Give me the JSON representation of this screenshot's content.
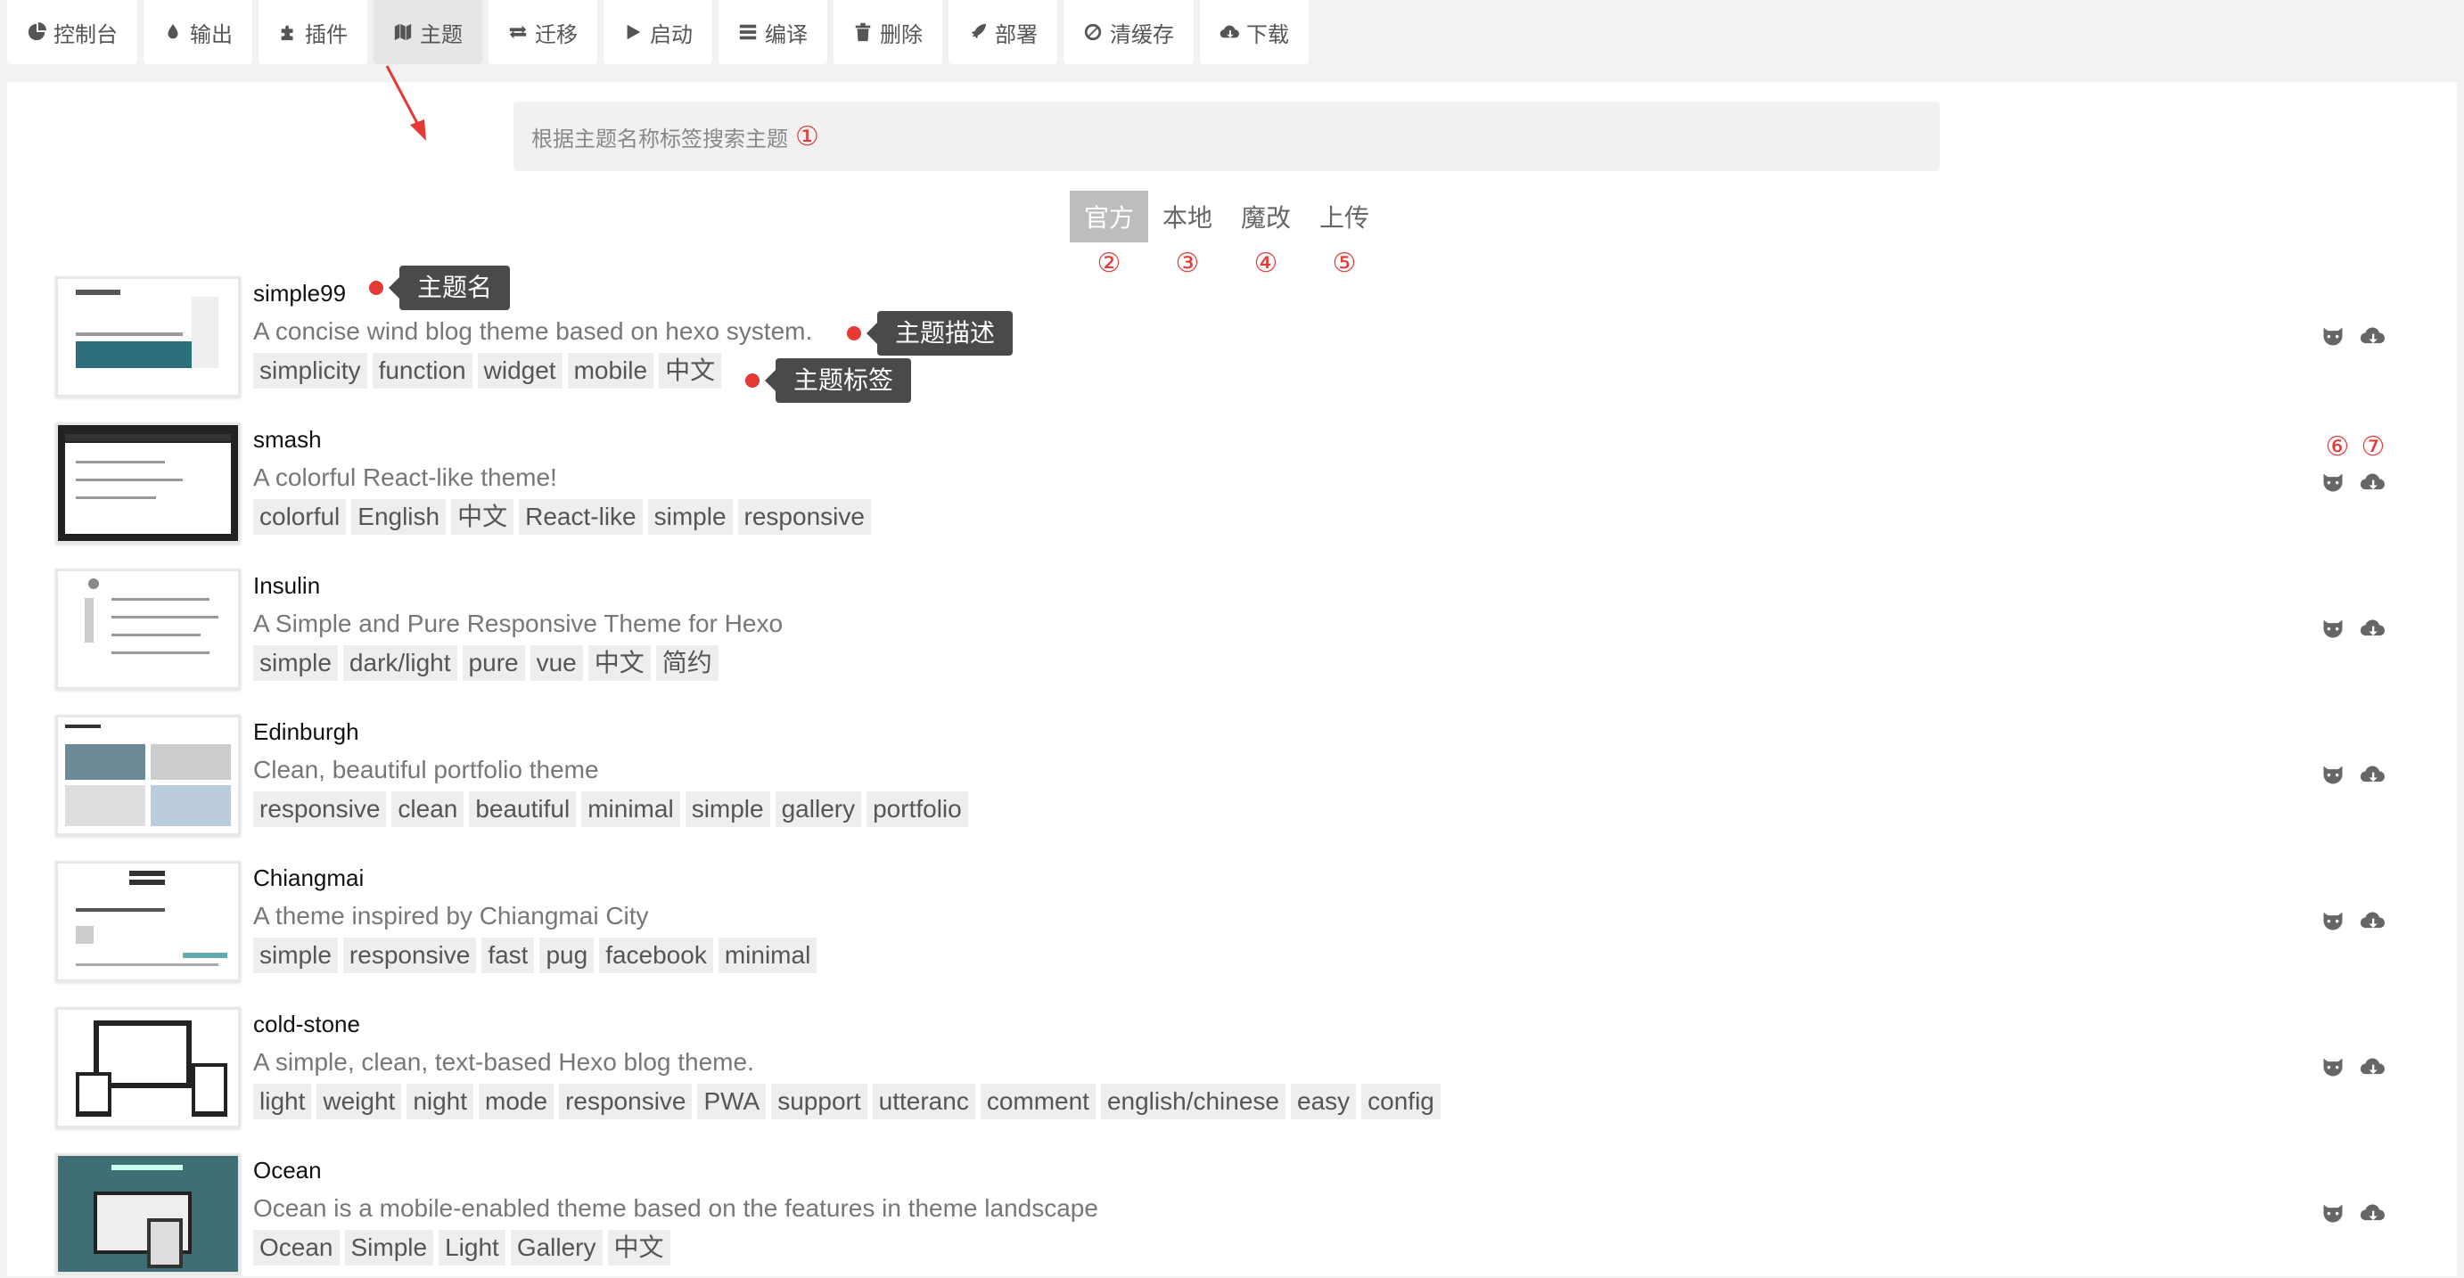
{
  "toolbar": {
    "items": [
      {
        "label": "控制台",
        "icon": "dashboard-icon"
      },
      {
        "label": "输出",
        "icon": "drop-icon"
      },
      {
        "label": "插件",
        "icon": "puzzle-icon"
      },
      {
        "label": "主题",
        "icon": "map-icon",
        "active": true
      },
      {
        "label": "迁移",
        "icon": "exchange-icon"
      },
      {
        "label": "启动",
        "icon": "play-icon"
      },
      {
        "label": "编译",
        "icon": "list-icon"
      },
      {
        "label": "删除",
        "icon": "trash-icon"
      },
      {
        "label": "部署",
        "icon": "rocket-icon"
      },
      {
        "label": "清缓存",
        "icon": "ban-icon"
      },
      {
        "label": "下载",
        "icon": "cloud-download-icon"
      }
    ]
  },
  "search": {
    "placeholder": "根据主题名称标签搜索主题",
    "marker": "①"
  },
  "tabs": [
    {
      "label": "官方",
      "marker": "②",
      "active": true
    },
    {
      "label": "本地",
      "marker": "③"
    },
    {
      "label": "魔改",
      "marker": "④"
    },
    {
      "label": "上传",
      "marker": "⑤"
    }
  ],
  "action_markers": [
    "⑥",
    "⑦"
  ],
  "callouts": {
    "name": "主题名",
    "desc": "主题描述",
    "tags": "主题标签"
  },
  "themes": [
    {
      "name": "simple99",
      "desc": "A concise wind blog theme based on hexo system.",
      "tags": [
        "simplicity",
        "function",
        "widget",
        "mobile",
        "中文"
      ]
    },
    {
      "name": "smash",
      "desc": "A colorful React-like theme!",
      "tags": [
        "colorful",
        "English",
        "中文",
        "React-like",
        "simple",
        "responsive"
      ]
    },
    {
      "name": "Insulin",
      "desc": "A Simple and Pure Responsive Theme for Hexo",
      "tags": [
        "simple",
        "dark/light",
        "pure",
        "vue",
        "中文",
        "简约"
      ]
    },
    {
      "name": "Edinburgh",
      "desc": "Clean, beautiful portfolio theme",
      "tags": [
        "responsive",
        "clean",
        "beautiful",
        "minimal",
        "simple",
        "gallery",
        "portfolio"
      ]
    },
    {
      "name": "Chiangmai",
      "desc": "A theme inspired by Chiangmai City",
      "tags": [
        "simple",
        "responsive",
        "fast",
        "pug",
        "facebook",
        "minimal"
      ]
    },
    {
      "name": "cold-stone",
      "desc": "A simple, clean, text-based Hexo blog theme.",
      "tags": [
        "light",
        "weight",
        "night",
        "mode",
        "responsive",
        "PWA",
        "support",
        "utteranc",
        "comment",
        "english/chinese",
        "easy",
        "config"
      ]
    },
    {
      "name": "Ocean",
      "desc": "Ocean is a mobile-enabled theme based on the features in theme landscape",
      "tags": [
        "Ocean",
        "Simple",
        "Light",
        "Gallery",
        "中文"
      ]
    }
  ],
  "colors": {
    "accent_red": "#e53935",
    "active_tab": "#bdbdbd",
    "tooltip_bg": "#4a4a4a"
  }
}
